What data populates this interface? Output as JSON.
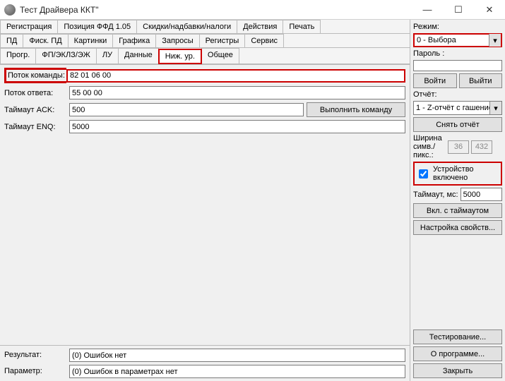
{
  "title": "Тест Драйвера ККТ\"",
  "winbuttons": {
    "min": "—",
    "max": "☐",
    "close": "✕"
  },
  "tabs_row1": [
    "Регистрация",
    "Позиция ФФД 1.05",
    "Скидки/надбавки/налоги",
    "Действия",
    "Печать"
  ],
  "tabs_row2": [
    "ПД",
    "Фиск. ПД",
    "Картинки",
    "Графика",
    "Запросы",
    "Регистры",
    "Сервис"
  ],
  "tabs_row3": [
    "Прогр.",
    "ФП/ЭКЛЗ/ЭЖ",
    "ЛУ",
    "Данные",
    "Ниж. ур.",
    "Общее"
  ],
  "form": {
    "cmd_stream_label": "Поток команды:",
    "cmd_stream_value": "82 01 06 00",
    "resp_stream_label": "Поток ответа:",
    "resp_stream_value": "55 00 00",
    "timeout_ack_label": "Таймаут ACK:",
    "timeout_ack_value": "500",
    "timeout_enq_label": "Таймаут ENQ:",
    "timeout_enq_value": "5000",
    "execute_btn": "Выполнить команду"
  },
  "status": {
    "result_label": "Результат:",
    "result_value": "(0) Ошибок нет",
    "param_label": "Параметр:",
    "param_value": "(0) Ошибок в параметрах нет"
  },
  "side": {
    "mode_label": "Режим:",
    "mode_value": "0 - Выбора",
    "password_label": "Пароль :",
    "password_value": "",
    "login_btn": "Войти",
    "logout_btn": "Выйти",
    "report_label": "Отчёт:",
    "report_value": "1 - Z-отчёт с гашение",
    "take_report_btn": "Снять отчёт",
    "width_label": "Ширина симв./пикс.:",
    "width_chars": "36",
    "width_px": "432",
    "device_on_label": "Устройство включено",
    "timeout_ms_label": "Таймаут, мс:",
    "timeout_ms_value": "5000",
    "on_with_timeout_btn": "Вкл. с таймаутом",
    "props_btn": "Настройка свойств...",
    "test_btn": "Тестирование...",
    "about_btn": "О программе...",
    "close_btn": "Закрыть"
  }
}
